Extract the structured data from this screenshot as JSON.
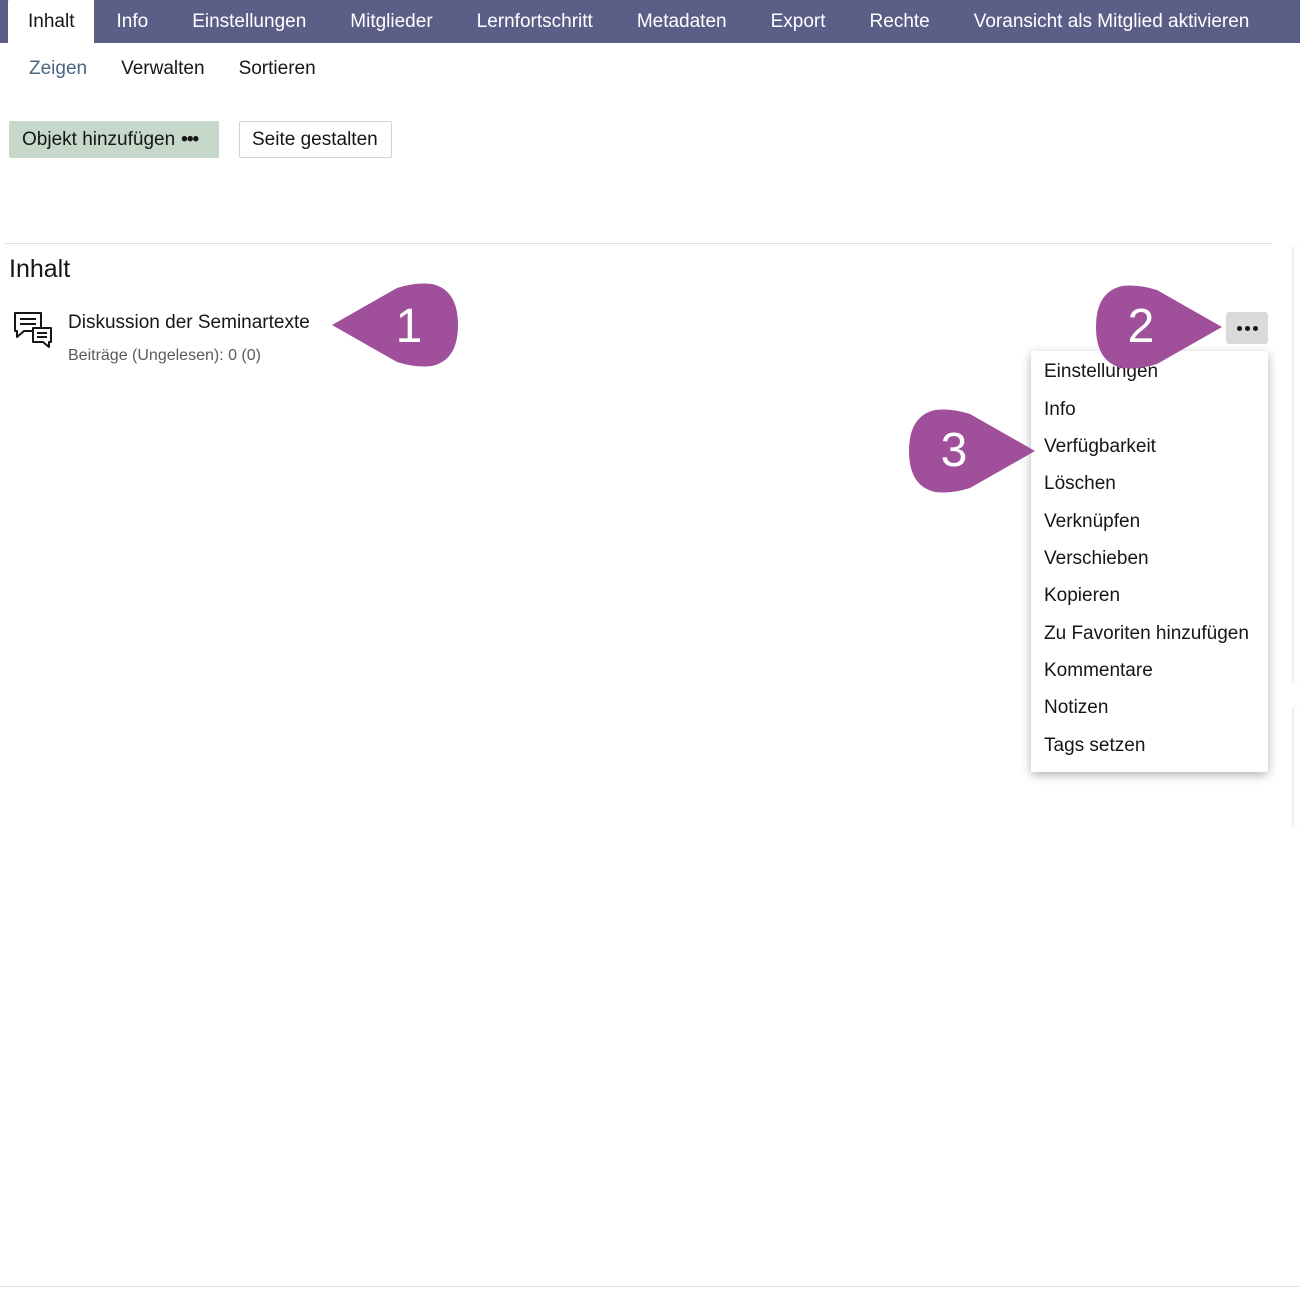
{
  "tabs": [
    {
      "label": "Inhalt",
      "active": true
    },
    {
      "label": "Info"
    },
    {
      "label": "Einstellungen"
    },
    {
      "label": "Mitglieder"
    },
    {
      "label": "Lernfortschritt"
    },
    {
      "label": "Metadaten"
    },
    {
      "label": "Export"
    },
    {
      "label": "Rechte"
    },
    {
      "label": "Voransicht als Mitglied aktivieren"
    }
  ],
  "subtabs": [
    {
      "label": "Zeigen",
      "active": true
    },
    {
      "label": "Verwalten"
    },
    {
      "label": "Sortieren"
    }
  ],
  "toolbar": {
    "add_label": "Objekt hinzufügen",
    "add_dots": "•••",
    "design_label": "Seite gestalten"
  },
  "content": {
    "section_title": "Inhalt",
    "item": {
      "icon": "forum-icon",
      "title": "Diskussion der Seminartexte",
      "property": "Beiträge (Ungelesen): 0 (0)"
    }
  },
  "actions_menu": {
    "items": [
      "Einstellungen",
      "Info",
      "Verfügbarkeit",
      "Löschen",
      "Verknüpfen",
      "Verschieben",
      "Kopieren",
      "Zu Favoriten hinzufügen",
      "Kommentare",
      "Notizen",
      "Tags setzen"
    ]
  },
  "markers": [
    {
      "number": "1"
    },
    {
      "number": "2"
    },
    {
      "number": "3"
    }
  ],
  "colors": {
    "tabbar": "#5b5f88",
    "marker": "#a0509b",
    "add_button": "#c5d8c9"
  }
}
